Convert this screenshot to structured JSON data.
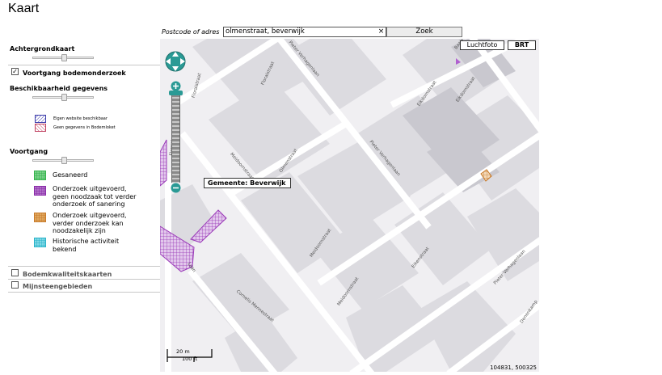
{
  "page": {
    "title": "Kaart"
  },
  "sidebar": {
    "achtergrondkaart": {
      "label": "Achtergrondkaart",
      "slider": 0.5
    },
    "voortgang_bodem": {
      "label": "Voortgang bodemonderzoek",
      "checked": true
    },
    "beschikbaarheid": {
      "label": "Beschikbaarheid gegevens",
      "slider": 0.5,
      "legend": [
        {
          "label": "Eigen website beschikbaar",
          "color": "#3a3aaa"
        },
        {
          "label": "Geen gegevens in Bodemloket",
          "color": "#c04060"
        }
      ]
    },
    "voortgang": {
      "label": "Voortgang",
      "slider": 0.5,
      "legend": [
        {
          "label_lines": [
            "Gesaneerd"
          ],
          "color": "#33b24a"
        },
        {
          "label_lines": [
            "Onderzoek uitgevoerd,",
            "geen noodzaak tot verder",
            "onderzoek of sanering"
          ],
          "color": "#8a2aa8"
        },
        {
          "label_lines": [
            "Onderzoek uitgevoerd,",
            "verder onderzoek kan",
            "noodzakelijk zijn"
          ],
          "color": "#c87a2a"
        },
        {
          "label_lines": [
            "Historische activiteit",
            "bekend"
          ],
          "color": "#28b2c8"
        }
      ]
    },
    "bodemkwaliteit": {
      "label": "Bodemkwaliteitskaarten",
      "checked": false
    },
    "mijnsteen": {
      "label": "Mijnsteengebieden",
      "checked": false
    }
  },
  "search": {
    "caption": "Postcode of adres",
    "value": "olmenstraat, beverwijk",
    "clear": "×",
    "button": "Zoek"
  },
  "map": {
    "buttons": {
      "luchtfoto": "Luchtfoto",
      "brt": "BRT"
    },
    "municipality_label": "Gemeente: Beverwijk",
    "scale_m": "20 m",
    "scale_ft": "100 ft",
    "coordinates": "104831, 500325",
    "streets": [
      {
        "name": "Floraistraat",
        "r": -75
      },
      {
        "name": "Floraistraat",
        "r": -65
      },
      {
        "name": "Pieter Verhagenlaan",
        "r": 50
      },
      {
        "name": "Pieter Verhagenlaan",
        "r": 50
      },
      {
        "name": "Pieter Verhagenlaan",
        "r": -48
      },
      {
        "name": "Eikdornstraat",
        "r": -55
      },
      {
        "name": "Eikdornstraat",
        "r": -55
      },
      {
        "name": "Eikenstraat",
        "r": -52
      },
      {
        "name": "Olmenstraat",
        "r": -55
      },
      {
        "name": "Meidoornstraat",
        "r": 50
      },
      {
        "name": "Meidoornstraat",
        "r": -55
      },
      {
        "name": "Meidoornstraat",
        "r": -55
      },
      {
        "name": "Floraistraat",
        "r": -85
      },
      {
        "name": "Cornelis Mennestraat",
        "r": 40
      },
      {
        "name": "Denenkamp",
        "r": -55
      },
      {
        "name": "Baaiye",
        "r": -55
      },
      {
        "name": "Laan",
        "r": 55
      }
    ],
    "icons": [
      "pan-icon",
      "zoom-in-icon",
      "zoom-out-icon"
    ]
  }
}
